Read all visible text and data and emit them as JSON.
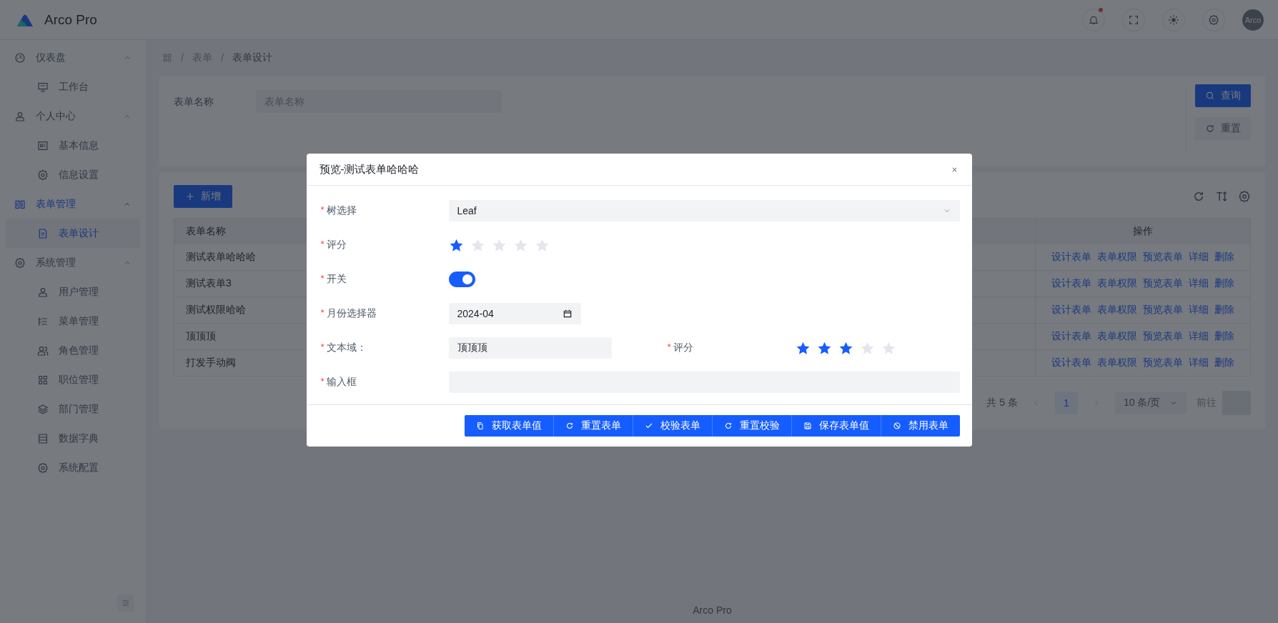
{
  "header": {
    "title": "Arco Pro",
    "notification_dot": true,
    "avatar": "Arco"
  },
  "menu": [
    {
      "label": "仪表盘",
      "expanded": true,
      "selected": false,
      "children": [
        {
          "label": "工作台",
          "selected": false
        }
      ]
    },
    {
      "label": "个人中心",
      "expanded": true,
      "selected": false,
      "children": [
        {
          "label": "基本信息",
          "selected": false
        },
        {
          "label": "信息设置",
          "selected": false
        }
      ]
    },
    {
      "label": "表单管理",
      "expanded": true,
      "selected": true,
      "children": [
        {
          "label": "表单设计",
          "selected": true
        }
      ]
    },
    {
      "label": "系统管理",
      "expanded": true,
      "selected": false,
      "children": [
        {
          "label": "用户管理",
          "selected": false
        },
        {
          "label": "菜单管理",
          "selected": false
        },
        {
          "label": "角色管理",
          "selected": false
        },
        {
          "label": "职位管理",
          "selected": false
        },
        {
          "label": "部门管理",
          "selected": false
        },
        {
          "label": "数据字典",
          "selected": false
        },
        {
          "label": "系统配置",
          "selected": false
        }
      ]
    }
  ],
  "breadcrumb": [
    {
      "separator": "/",
      "label": "表单"
    },
    {
      "separator": "/",
      "label": "表单设计"
    }
  ],
  "search": {
    "label": "表单名称",
    "placeholder": "表单名称",
    "buttons": [
      "查询",
      "重置"
    ]
  },
  "table": {
    "add_button": "新增",
    "columns": [
      "表单名称",
      "操作"
    ],
    "rows": [
      {
        "name": "测试表单哈哈哈",
        "actions": [
          "设计表单",
          "表单权限",
          "预览表单",
          "详细",
          "删除"
        ]
      },
      {
        "name": "测试表单3",
        "actions": [
          "设计表单",
          "表单权限",
          "预览表单",
          "详细",
          "删除"
        ]
      },
      {
        "name": "测试权限哈哈",
        "actions": [
          "设计表单",
          "表单权限",
          "预览表单",
          "详细",
          "删除"
        ]
      },
      {
        "name": "顶顶顶",
        "actions": [
          "设计表单",
          "表单权限",
          "预览表单",
          "详细",
          "删除"
        ]
      },
      {
        "name": "打发手动阀",
        "actions": [
          "设计表单",
          "表单权限",
          "预览表单",
          "详细",
          "删除"
        ]
      }
    ]
  },
  "pagination": {
    "total": "共 5 条",
    "pages": [
      {
        "label": "1",
        "selected": true
      }
    ],
    "page_size": "10 条/页",
    "goto": "前往"
  },
  "modal": {
    "title": "预览-测试表单哈哈哈",
    "rows": [
      [
        {
          "kind": "select",
          "mark": "*",
          "label": "树选择",
          "value": "Leaf"
        }
      ],
      [
        {
          "kind": "rate",
          "mark": "*",
          "label": "评分",
          "stars": 1
        }
      ],
      [
        {
          "kind": "switch",
          "mark": "*",
          "label": "开关",
          "on": true
        }
      ],
      [
        {
          "kind": "month",
          "mark": "*",
          "label": "月份选择器",
          "value": "2024-04"
        }
      ],
      [
        {
          "kind": "textarea",
          "mark": "*",
          "label": "文本域：",
          "value": "顶顶顶"
        },
        {
          "kind": "rate",
          "mark": "*",
          "label": "评分",
          "stars": 3
        }
      ],
      [
        {
          "kind": "input",
          "mark": "*",
          "label": "输入框"
        }
      ]
    ],
    "buttons": [
      "获取表单值",
      "重置表单",
      "校验表单",
      "重置校验",
      "保存表单值",
      "禁用表单"
    ]
  },
  "footer": "Arco Pro"
}
